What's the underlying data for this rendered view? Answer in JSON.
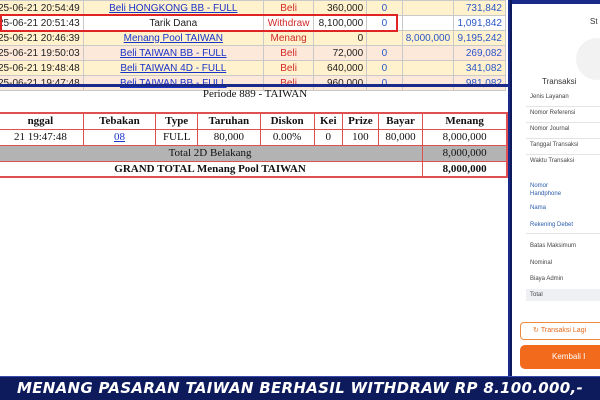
{
  "transactions": [
    {
      "date": "25-06-21 20:54:49",
      "description": "Beli HONGKONG BB - FULL",
      "type": "Beli",
      "amount": "360,000",
      "a2": "0",
      "a3": "",
      "balance": "731,842",
      "link": true
    },
    {
      "date": "25-06-21 20:51:43",
      "description": "Tarik Dana",
      "type": "Withdraw",
      "amount": "8,100,000",
      "a2": "0",
      "a3": "",
      "balance": "1,091,842",
      "link": false
    },
    {
      "date": "25-06-21 20:46:39",
      "description": "Menang Pool TAIWAN",
      "type": "Menang",
      "amount": "0",
      "a2": "",
      "a3": "8,000,000",
      "balance": "9,195,242",
      "link": true
    },
    {
      "date": "25-06-21 19:50:03",
      "description": "Beli TAIWAN BB - FULL",
      "type": "Beli",
      "amount": "72,000",
      "a2": "0",
      "a3": "",
      "balance": "269,082",
      "link": true
    },
    {
      "date": "25-06-21 19:48:48",
      "description": "Beli TAIWAN 4D - FULL",
      "type": "Beli",
      "amount": "640,000",
      "a2": "0",
      "a3": "",
      "balance": "341,082",
      "link": true
    },
    {
      "date": "25-06-21 19:47:48",
      "description": "Beli TAIWAN BB - FULL",
      "type": "Beli",
      "amount": "960,000",
      "a2": "0",
      "a3": "",
      "balance": "981,082",
      "link": true
    }
  ],
  "periode_title": "Periode 889 - TAIWAN",
  "bet_table": {
    "headers": [
      "nggal",
      "Tebakan",
      "Type",
      "Taruhan",
      "Diskon",
      "Kei",
      "Prize",
      "Bayar",
      "Menang"
    ],
    "row": [
      "21 19:47:48",
      "08",
      "FULL",
      "80,000",
      "0.00%",
      "0",
      "100",
      "80,000",
      "8,000,000"
    ],
    "subtotal_label": "Total 2D Belakang",
    "subtotal_value": "8,000,000",
    "grand_label": "GRAND TOTAL  Menang Pool TAIWAN",
    "grand_value": "8,000,000"
  },
  "receipt": {
    "status_partial": "St",
    "title_partial": "Transaksi",
    "fields": [
      "Jenis Layanan",
      "Nomor Referensi",
      "Nomor Journal",
      "Tanggal Transaksi",
      "Waktu Transaksi"
    ],
    "account_fields": [
      "Nomor Handphone",
      "Nama",
      "Rekening Debet"
    ],
    "amount_fields": [
      "Batas Maksimum",
      "Nominal",
      "Biaya Admin"
    ],
    "total_label": "Total",
    "retry_button": "Transaksi Lagi",
    "back_button": "Kembali I"
  },
  "banner_text": "MENANG PASARAN TAIWAN BERHASIL WITHDRAW RP 8.100.000,-",
  "colors": {
    "highlight": "#e02424",
    "banner_bg": "#0d1b5c",
    "button_orange": "#f26a1b"
  },
  "icons": {
    "retry": "refresh-icon"
  }
}
